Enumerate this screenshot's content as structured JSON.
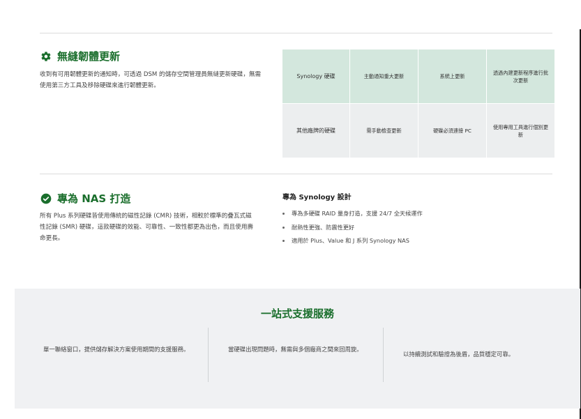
{
  "colors": {
    "accent": "#1a6e2c",
    "table_header_bg": "#d3e7dd",
    "table_row_bg": "#eceeef",
    "support_bg": "#f0f1f3"
  },
  "firmware": {
    "icon": "gear-icon",
    "title": "無縫韌體更新",
    "description": "收到有可用韌體更新的通知時，可透過 DSM 的儲存空間管理員無縫更新硬碟，無需使用第三方工具及移除硬碟來進行韌體更新。"
  },
  "comparison": {
    "rows": [
      {
        "cells": [
          "Synology 硬碟",
          "主動通知重大更新",
          "系統上更新",
          "透過內建更新程序進行批次更新"
        ]
      },
      {
        "cells": [
          "其他廠牌的硬碟",
          "需手動檢查更新",
          "硬碟必須連接 PC",
          "使用專用工具進行個別更新"
        ]
      }
    ]
  },
  "nas": {
    "icon": "check-circle-icon",
    "title": "專為 NAS 打造",
    "description": "所有 Plus 系列硬碟皆使用傳統的磁性記錄 (CMR) 技術，相較於標準的疊瓦式磁性記錄 (SMR) 硬碟，這款硬碟的效能、可靠性、一致性都更為出色，而且使用壽命更長。"
  },
  "design": {
    "title": "專為 Synology 設計",
    "bullets": [
      "專為多硬碟 RAID 量身打造，支援 24/7 全天候運作",
      "耐熱性更強、防震性更好",
      "適用於 Plus、Value 和 J 系列 Synology NAS"
    ]
  },
  "support": {
    "title": "一站式支援服務",
    "items": [
      "單一聯絡窗口，提供儲存解決方案使用期間的支援服務。",
      "當硬碟出現問題時，無需與多個廠商之間來回周旋。",
      "以持續測試和驗證為後盾，品質穩定可靠。"
    ]
  }
}
